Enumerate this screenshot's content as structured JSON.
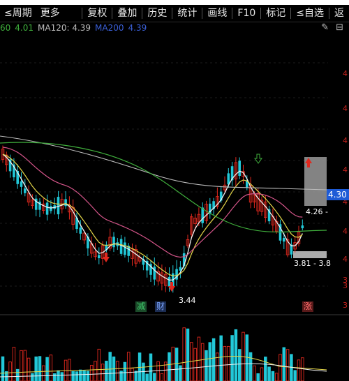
{
  "toolbar": {
    "period": "≤周期",
    "more": "更多",
    "buttons": [
      "复权",
      "叠加",
      "历史",
      "统计",
      "画线",
      "F10",
      "标记",
      "≤自选",
      "返"
    ]
  },
  "ma_legend": {
    "ma60_label": "60",
    "ma60_value": "4.01",
    "ma120": "MA120: 4.39",
    "ma200_label": "MA200",
    "ma200_value": "4.39"
  },
  "price_labels": {
    "low": "3.44",
    "level_upper": "4.26 -",
    "range": "3.81 - 3.8"
  },
  "current_price": "4.30",
  "markers": {
    "jian": "减",
    "cai": "财",
    "zhang": "涨"
  },
  "right_axis": [
    "4",
    "4",
    "4",
    "4",
    "4",
    "4",
    "4",
    "3",
    "3",
    "3"
  ],
  "colors": {
    "up": "#e0281e",
    "down": "#22c8d8",
    "ma_white": "#f2f2f2",
    "ma_yellow": "#e6d84a",
    "ma_pink": "#d5558a",
    "ma_green": "#3fae3c",
    "ma_gray": "#bcbcbc",
    "accent_blue": "#1e5bd6"
  },
  "icons": {
    "edit": "✎",
    "minus": "⊟"
  }
}
